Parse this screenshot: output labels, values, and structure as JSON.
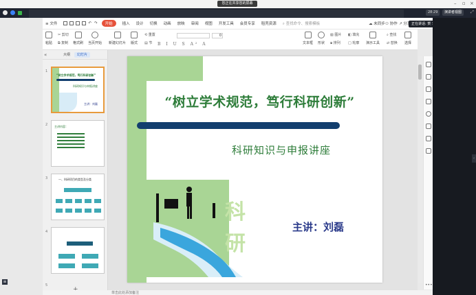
{
  "share_bar": {
    "label": "您正在共享您的屏幕"
  },
  "tab_bar": {
    "time": "28:29",
    "presenter_view": "演讲者视图"
  },
  "presenter_chip": "正在讲话: 贺 李秀迪",
  "menu": {
    "file": "文件",
    "items": [
      "开始",
      "插入",
      "设计",
      "切换",
      "动画",
      "放映",
      "审阅",
      "视图",
      "开发工具",
      "会员专享",
      "稻壳资源"
    ],
    "search": "查找命令、搜索模板",
    "unsynced": "未同步",
    "collab": "协作",
    "share": "分享"
  },
  "toolbar": {
    "paste": "粘贴",
    "cut": "剪切",
    "copy": "复制",
    "format_painter": "格式刷",
    "play_from_current": "当页开始",
    "new_slide": "新建幻灯片",
    "layout": "版式",
    "section": "节",
    "reset": "重置",
    "font_size": "0",
    "textbox": "文本框",
    "shape": "形状",
    "arrange": "排列",
    "outline": "轮廓",
    "picture": "图片",
    "fill": "填充",
    "replace": "替换",
    "find": "查找",
    "select": "选择",
    "presentation_tools": "演示工具"
  },
  "thumb_panel": {
    "tab_outline": "大纲",
    "tab_slides": "幻灯片",
    "slide_numbers": [
      "1",
      "2",
      "3",
      "4",
      "5"
    ]
  },
  "slide": {
    "title": "“树立学术规范，笃行科研创新”",
    "subtitle": "科研知识与申报讲座",
    "speaker": "主讲：刘磊",
    "watermark_chars": [
      "科",
      "研"
    ]
  },
  "thumbs": {
    "s1_title": "“树立学术规范，笃行科研创新”",
    "s1_sub": "科研知识与申报讲座",
    "s1_speaker": "主讲：刘磊",
    "s2_heading": "主讲内容：",
    "s3_heading": "一、科研项目的类型及分类"
  },
  "status": {
    "notes_placeholder": "单击此处添加备注"
  },
  "colors": {
    "accent_green": "#a9d595",
    "title_green": "#2e7d3a",
    "navy": "#123e6e",
    "menu_active": "#e6513a",
    "selection_orange": "#e89a3c"
  }
}
